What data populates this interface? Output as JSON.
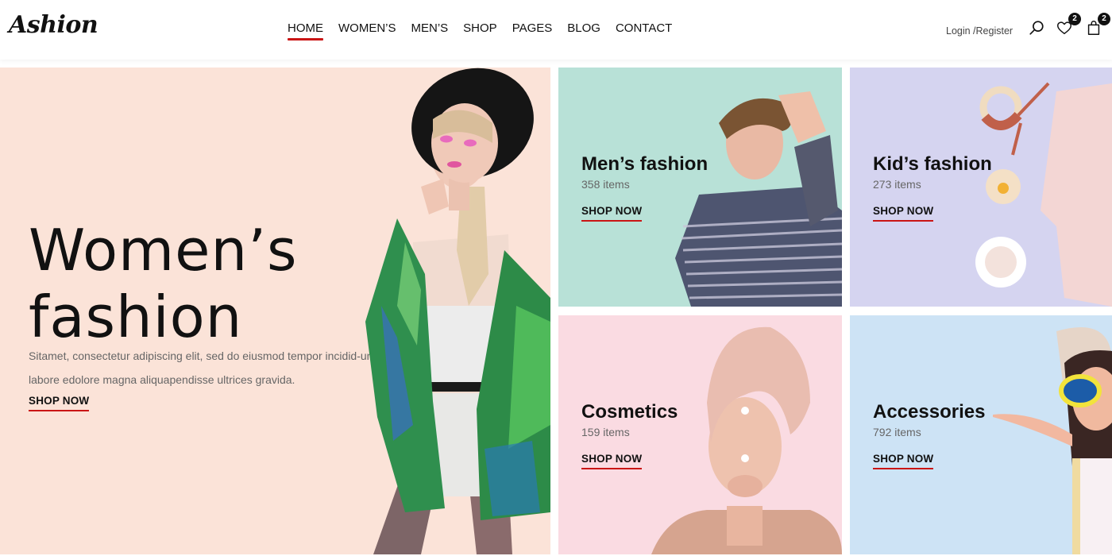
{
  "header": {
    "logo": "Ashion",
    "nav": [
      {
        "label": "HOME",
        "active": true
      },
      {
        "label": "WOMEN’S",
        "active": false
      },
      {
        "label": "MEN’S",
        "active": false
      },
      {
        "label": "SHOP",
        "active": false
      },
      {
        "label": "PAGES",
        "active": false
      },
      {
        "label": "BLOG",
        "active": false
      },
      {
        "label": "CONTACT",
        "active": false
      }
    ],
    "login_register": "Login /Register",
    "icons": {
      "search": "search-icon",
      "wishlist": "heart-icon",
      "cart": "shopping-bag-icon"
    },
    "wishlist_count": "2",
    "cart_count": "2"
  },
  "hero": {
    "title_line1": "Women’s",
    "title_line2": "fashion",
    "description": "Sitamet, consectetur adipiscing elit, sed do eiusmod tempor incidid-unt labore edolore magna aliquapendisse ultrices gravida.",
    "cta": "SHOP NOW",
    "background": "#fbe3d8"
  },
  "categories": [
    {
      "title": "Men’s fashion",
      "count": "358 items",
      "cta": "SHOP NOW",
      "background": "#b8e1d7"
    },
    {
      "title": "Kid’s fashion",
      "count": "273 items",
      "cta": "SHOP NOW",
      "background": "#d5d4f0"
    },
    {
      "title": "Cosmetics",
      "count": "159 items",
      "cta": "SHOP NOW",
      "background": "#fadbe2"
    },
    {
      "title": "Accessories",
      "count": "792 items",
      "cta": "SHOP NOW",
      "background": "#cde3f5"
    }
  ],
  "colors": {
    "accent": "#ca1515",
    "text": "#111111",
    "muted": "#666666"
  }
}
